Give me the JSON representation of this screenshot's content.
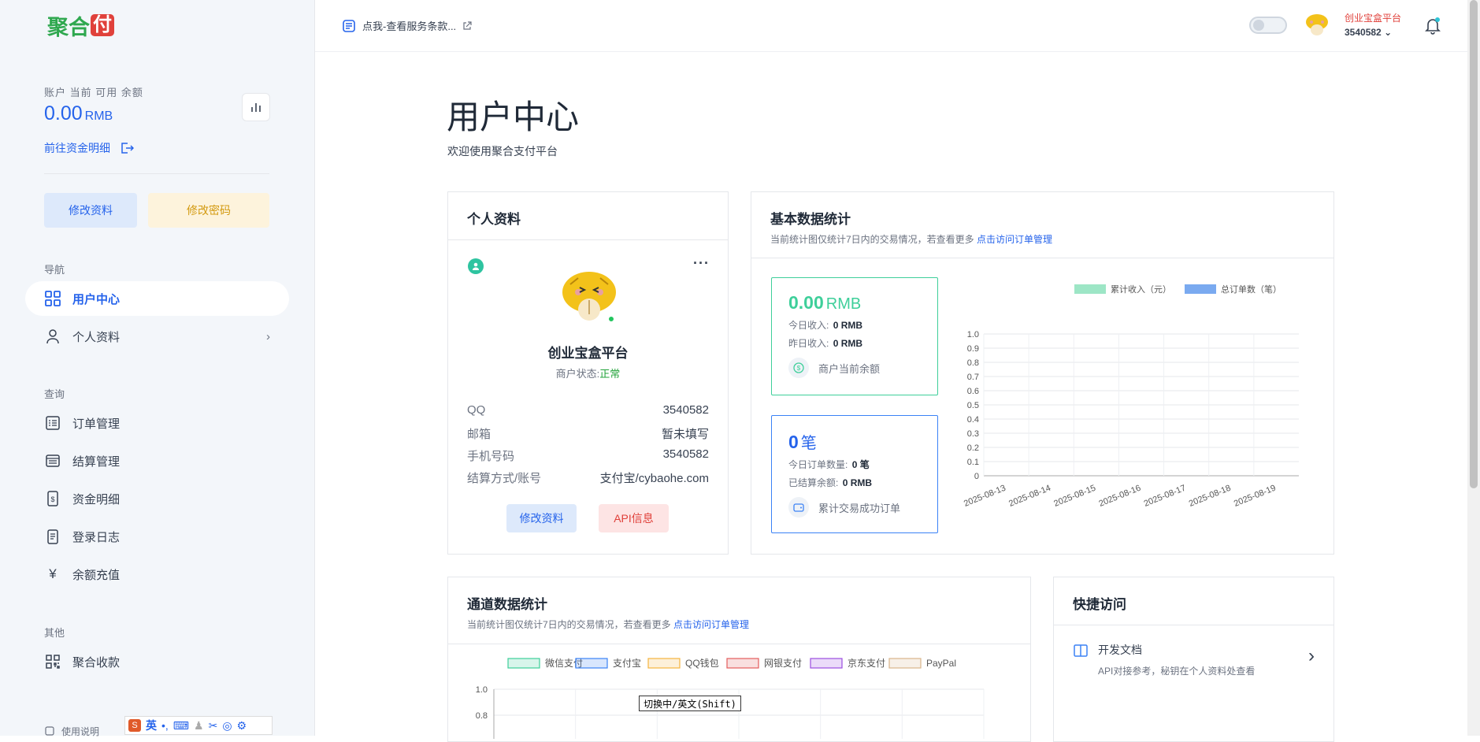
{
  "brand": {
    "logo_part1": "聚合",
    "logo_part2": "付"
  },
  "sidebar": {
    "balance_label": "账户 当前 可用 余额",
    "balance_value": "0.00",
    "balance_unit": "RMB",
    "fund_link": "前往资金明细",
    "btn_edit_profile": "修改资料",
    "btn_change_password": "修改密码",
    "sections": {
      "nav": "导航",
      "query": "查询",
      "other": "其他"
    },
    "items": {
      "user_center": "用户中心",
      "profile": "个人资料",
      "orders": "订单管理",
      "settlement": "结算管理",
      "funds": "资金明细",
      "login_log": "登录日志",
      "recharge": "余额充值",
      "aggregate": "聚合收款",
      "manual": "使用说明"
    },
    "ime": {
      "mode": "英"
    }
  },
  "topbar": {
    "notice": "点我-查看服务条款...",
    "user_name": "创业宝盒平台",
    "user_id": "3540582"
  },
  "page": {
    "title": "用户中心",
    "subtitle": "欢迎使用聚合支付平台"
  },
  "profile_card": {
    "title": "个人资料",
    "name": "创业宝盒平台",
    "status_label": "商户状态:",
    "status_value": "正常",
    "rows": [
      {
        "k": "QQ",
        "v": "3540582"
      },
      {
        "k": "邮箱",
        "v": "暂未填写"
      },
      {
        "k": "手机号码",
        "v": "3540582"
      },
      {
        "k": "结算方式/账号",
        "v": "支付宝/cybaohe.com"
      }
    ],
    "btn_edit": "修改资料",
    "btn_api": "API信息"
  },
  "stats_card": {
    "title": "基本数据统计",
    "subtitle": "当前统计图仅统计7日内的交易情况，若查看更多",
    "subtitle_link": "点击访问订单管理",
    "income": {
      "value": "0.00",
      "unit": "RMB",
      "today_label": "今日收入:",
      "today_value": "0 RMB",
      "yesterday_label": "昨日收入:",
      "yesterday_value": "0 RMB",
      "footer": "商户当前余额",
      "color": "#3ecf9a"
    },
    "orders": {
      "value": "0",
      "unit": "笔",
      "today_label": "今日订单数量:",
      "today_value": "0 笔",
      "settled_label": "已结算余额:",
      "settled_value": "0 RMB",
      "footer": "累计交易成功订单",
      "color": "#3b82f6"
    }
  },
  "channel_card": {
    "title": "通道数据统计",
    "subtitle": "当前统计图仅统计7日内的交易情况，若查看更多",
    "subtitle_link": "点击访问订单管理"
  },
  "quick_card": {
    "title": "快捷访问",
    "item_title": "开发文档",
    "item_desc": "API对接参考，秘钥在个人资料处查看"
  },
  "ime_tooltip": "切换中/英文(Shift)",
  "chart_data": [
    {
      "type": "bar",
      "categories": [
        "2025-08-13",
        "2025-08-14",
        "2025-08-15",
        "2025-08-16",
        "2025-08-17",
        "2025-08-18",
        "2025-08-19"
      ],
      "series": [
        {
          "name": "累计收入（元）",
          "values": [
            0,
            0,
            0,
            0,
            0,
            0,
            0
          ],
          "color": "#9de6c6"
        },
        {
          "name": "总订单数（笔）",
          "values": [
            0,
            0,
            0,
            0,
            0,
            0,
            0
          ],
          "color": "#7aaaf0"
        }
      ],
      "yticks": [
        "1.0",
        "0.9",
        "0.8",
        "0.7",
        "0.6",
        "0.5",
        "0.4",
        "0.3",
        "0.2",
        "0.1",
        "0"
      ],
      "ylim": [
        0,
        1
      ],
      "legend": "top",
      "grid": true
    },
    {
      "type": "bar",
      "series": [
        {
          "name": "微信支付",
          "color": "#3ecf9a"
        },
        {
          "name": "支付宝",
          "color": "#3b82f6"
        },
        {
          "name": "QQ钱包",
          "color": "#f5b53f"
        },
        {
          "name": "网银支付",
          "color": "#e35d5d"
        },
        {
          "name": "京东支付",
          "color": "#9b4de0"
        },
        {
          "name": "PayPal",
          "color": "#d9b48a"
        }
      ],
      "yticks": [
        "1.0",
        "0.8"
      ],
      "ylim": [
        0,
        1
      ],
      "legend": "top",
      "grid": true
    }
  ]
}
